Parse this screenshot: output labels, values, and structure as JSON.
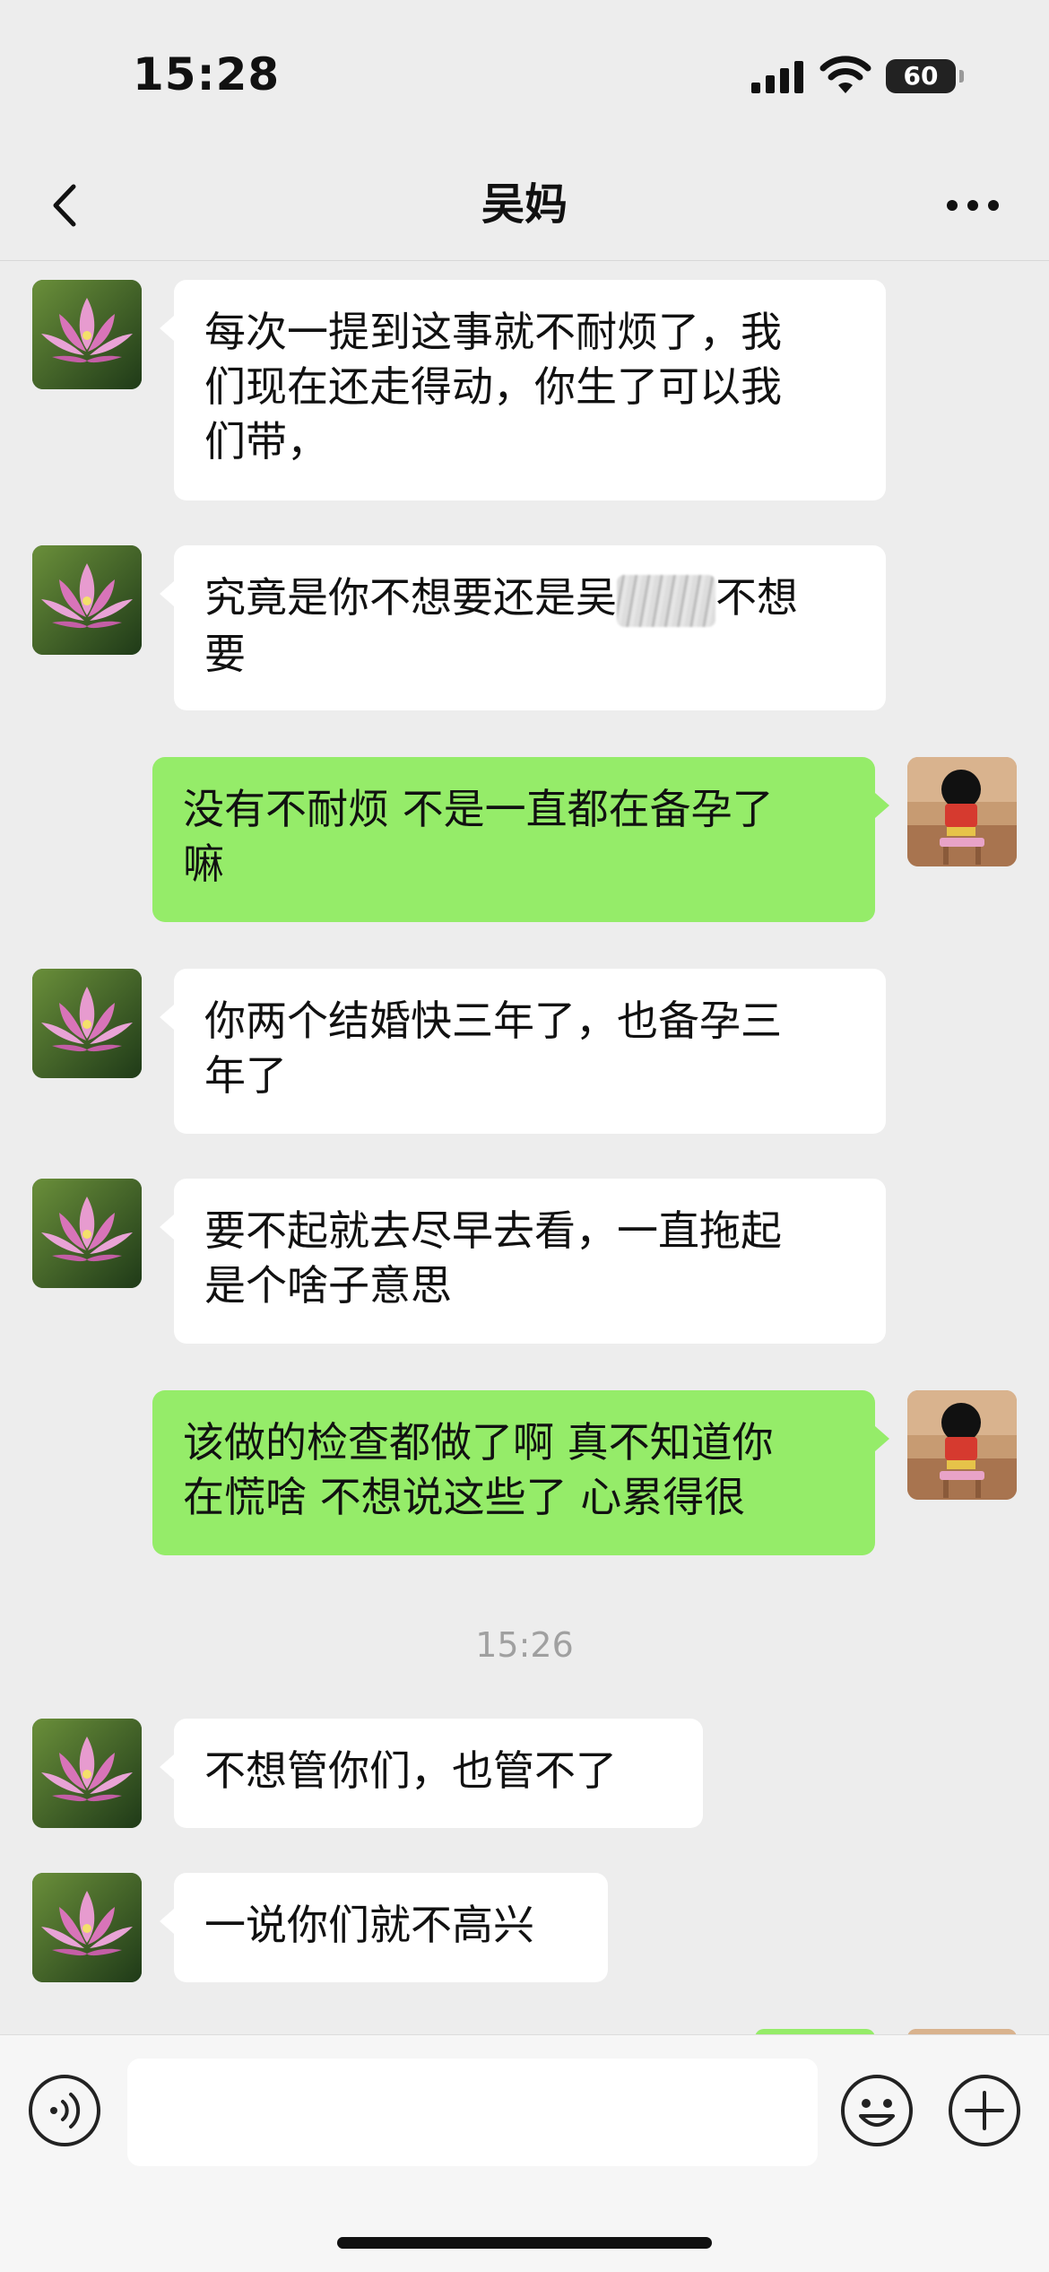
{
  "status_bar": {
    "time": "15:28",
    "battery": "60"
  },
  "nav": {
    "title": "吴妈"
  },
  "messages": [
    {
      "side": "in",
      "text": "每次一提到这事就不耐烦了，我们现在还走得动，你生了可以我们带，",
      "lines": [
        "每次一提到这事就不耐烦了，我",
        "们现在还走得动，你生了可以我",
        "们带，"
      ]
    },
    {
      "side": "in",
      "text_before": "究竟是你不想要还是吴",
      "text_after": "不想",
      "text_line2": "要"
    },
    {
      "side": "out",
      "lines": [
        "没有不耐烦 不是一直都在备孕了",
        "嘛"
      ]
    },
    {
      "side": "in",
      "lines": [
        "你两个结婚快三年了，也备孕三",
        "年了"
      ]
    },
    {
      "side": "in",
      "lines": [
        "要不起就去尽早去看，一直拖起",
        "是个啥子意思"
      ]
    },
    {
      "side": "out",
      "lines": [
        "该做的检查都做了啊 真不知道你",
        "在慌啥 不想说这些了 心累得很"
      ]
    },
    {
      "side": "in",
      "lines": [
        "不想管你们，也管不了"
      ]
    },
    {
      "side": "in",
      "lines": [
        "一说你们就不高兴"
      ]
    }
  ],
  "timestamp": "15:26",
  "colors": {
    "background": "#ededed",
    "outgoing_bubble": "#95ec69",
    "incoming_bubble": "#ffffff"
  },
  "icons": [
    "back-icon",
    "more-icon",
    "voice-icon",
    "emoji-icon",
    "plus-icon",
    "lotus-avatar",
    "cartoon-avatar"
  ]
}
